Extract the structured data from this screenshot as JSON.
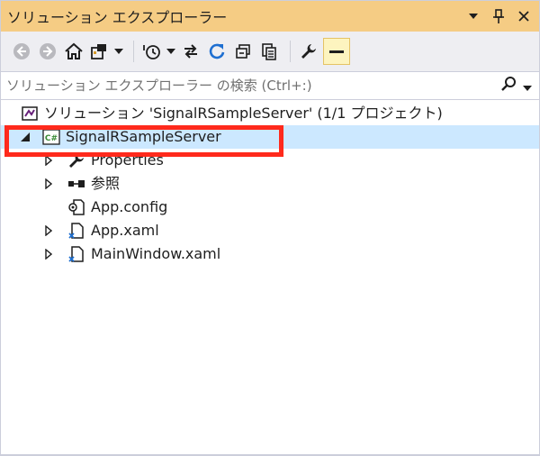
{
  "window": {
    "title": "ソリューション エクスプローラー"
  },
  "search": {
    "placeholder": "ソリューション エクスプローラー の検索 (Ctrl+:)"
  },
  "tree": {
    "solution_label": "ソリューション 'SignalRSampleServer' (1/1 プロジェクト)",
    "project_label": "SignalRSampleServer",
    "cs_badge": "C#",
    "items": [
      {
        "label": "Properties"
      },
      {
        "label": "参照"
      },
      {
        "label": "App.config"
      },
      {
        "label": "App.xaml"
      },
      {
        "label": "MainWindow.xaml"
      }
    ]
  },
  "colors": {
    "title_bar": "#f5cc84",
    "toolbar": "#eeeef2",
    "selection": "#cce8ff",
    "highlight": "#ff2a1c",
    "csharp_green": "#388a34",
    "refresh_blue": "#1e6fd1"
  }
}
